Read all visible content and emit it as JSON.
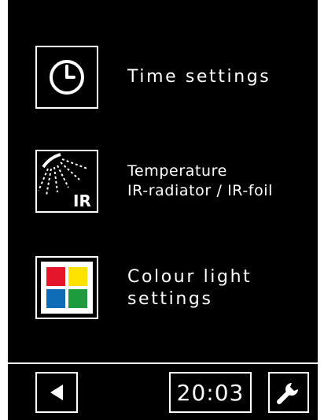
{
  "menu": {
    "items": [
      {
        "icon": "clock-icon",
        "label": "Time settings"
      },
      {
        "icon": "ir-radiator-icon",
        "label_line1": "Temperature",
        "label_line2": "IR-radiator / IR-foil",
        "badge": "IR"
      },
      {
        "icon": "colour-light-icon",
        "label_line1": "Colour light",
        "label_line2": "settings"
      }
    ]
  },
  "footer": {
    "back_icon": "back-arrow-icon",
    "clock": "20:03",
    "settings_icon": "wrench-icon"
  },
  "colors": {
    "background": "#000000",
    "foreground": "#ffffff",
    "swatch_red": "#e5152b",
    "swatch_yellow": "#ffe200",
    "swatch_blue": "#0f6cb6",
    "swatch_green": "#1e9c3d"
  }
}
